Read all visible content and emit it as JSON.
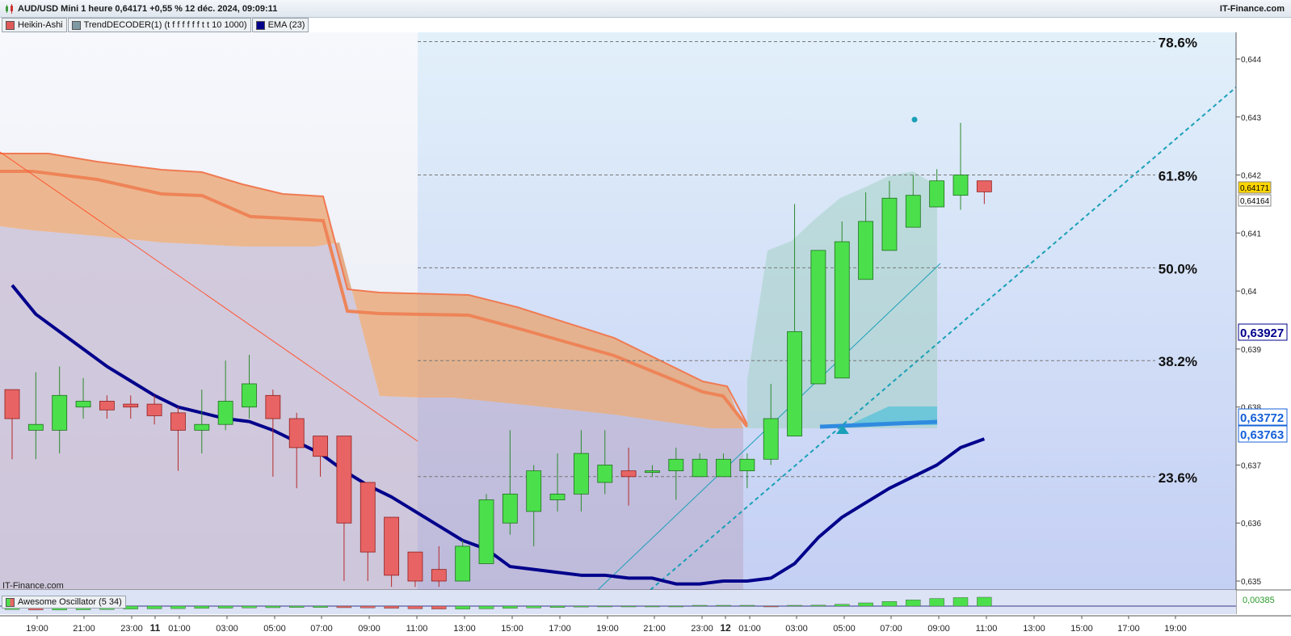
{
  "header": {
    "title": "AUD/USD Mini 1 heure 0,64171 +0,55 % 12 déc. 2024, 09:09:11",
    "brand": "IT-Finance.com"
  },
  "legend": [
    {
      "label": "Heikin-Ashi",
      "color": "#e05a5a"
    },
    {
      "label": "TrendDECODER(1) (t f f f f f f t t 10 1000)",
      "color": "#7f99a3"
    },
    {
      "label": "EMA (23)",
      "color": "#00008b"
    }
  ],
  "watermark": "IT-Finance.com",
  "oscillator": {
    "label": "Awesome Oscillator (5 34)",
    "value_label": "0,00385"
  },
  "chart_data": {
    "type": "candlestick",
    "title": "",
    "xlabel": "",
    "ylabel": "",
    "ylim": [
      0.6345,
      0.6445
    ],
    "y_ticks": [
      "0,644",
      "0,643",
      "0,642",
      "0,641",
      "0,64",
      "0,639",
      "0,638",
      "0,637",
      "0,636",
      "0,635"
    ],
    "x_ticks": [
      "19:00",
      "21:00",
      "23:00",
      "11",
      "01:00",
      "03:00",
      "05:00",
      "07:00",
      "09:00",
      "11:00",
      "13:00",
      "15:00",
      "17:00",
      "19:00",
      "21:00",
      "23:00",
      "12",
      "01:00",
      "03:00",
      "05:00",
      "07:00",
      "09:00",
      "11:00",
      "13:00",
      "15:00",
      "17:00",
      "19:00"
    ],
    "x_tick_bold": [
      "11",
      "12"
    ],
    "candles": [
      {
        "o": 0.6383,
        "h": 0.6383,
        "l": 0.6371,
        "c": 0.6378
      },
      {
        "o": 0.6376,
        "h": 0.6386,
        "l": 0.6371,
        "c": 0.6377
      },
      {
        "o": 0.6376,
        "h": 0.6387,
        "l": 0.6372,
        "c": 0.6382
      },
      {
        "o": 0.638,
        "h": 0.6385,
        "l": 0.6378,
        "c": 0.6381
      },
      {
        "o": 0.6381,
        "h": 0.6382,
        "l": 0.6378,
        "c": 0.63795
      },
      {
        "o": 0.63805,
        "h": 0.6382,
        "l": 0.6378,
        "c": 0.638
      },
      {
        "o": 0.63805,
        "h": 0.6382,
        "l": 0.6377,
        "c": 0.63785
      },
      {
        "o": 0.6379,
        "h": 0.638,
        "l": 0.6369,
        "c": 0.6376
      },
      {
        "o": 0.6376,
        "h": 0.6383,
        "l": 0.6372,
        "c": 0.6377
      },
      {
        "o": 0.6377,
        "h": 0.6388,
        "l": 0.6376,
        "c": 0.6381
      },
      {
        "o": 0.638,
        "h": 0.6389,
        "l": 0.6378,
        "c": 0.6384
      },
      {
        "o": 0.6382,
        "h": 0.6383,
        "l": 0.6368,
        "c": 0.6378
      },
      {
        "o": 0.6378,
        "h": 0.6379,
        "l": 0.6366,
        "c": 0.6373
      },
      {
        "o": 0.6375,
        "h": 0.6375,
        "l": 0.6368,
        "c": 0.63715
      },
      {
        "o": 0.6375,
        "h": 0.6375,
        "l": 0.635,
        "c": 0.636
      },
      {
        "o": 0.6367,
        "h": 0.6367,
        "l": 0.635,
        "c": 0.6355
      },
      {
        "o": 0.6361,
        "h": 0.6361,
        "l": 0.6349,
        "c": 0.6351
      },
      {
        "o": 0.6355,
        "h": 0.6355,
        "l": 0.6349,
        "c": 0.635
      },
      {
        "o": 0.6352,
        "h": 0.6356,
        "l": 0.6349,
        "c": 0.635
      },
      {
        "o": 0.635,
        "h": 0.6357,
        "l": 0.635,
        "c": 0.6356
      },
      {
        "o": 0.6353,
        "h": 0.6365,
        "l": 0.6353,
        "c": 0.6364
      },
      {
        "o": 0.636,
        "h": 0.6376,
        "l": 0.6358,
        "c": 0.6365
      },
      {
        "o": 0.6362,
        "h": 0.637,
        "l": 0.6356,
        "c": 0.6369
      },
      {
        "o": 0.6364,
        "h": 0.6372,
        "l": 0.6362,
        "c": 0.6365
      },
      {
        "o": 0.6365,
        "h": 0.6376,
        "l": 0.6362,
        "c": 0.6372
      },
      {
        "o": 0.6367,
        "h": 0.6376,
        "l": 0.6365,
        "c": 0.637
      },
      {
        "o": 0.6369,
        "h": 0.6373,
        "l": 0.6363,
        "c": 0.6368
      },
      {
        "o": 0.6369,
        "h": 0.637,
        "l": 0.6368,
        "c": 0.6369
      },
      {
        "o": 0.6369,
        "h": 0.6373,
        "l": 0.6364,
        "c": 0.6371
      },
      {
        "o": 0.6368,
        "h": 0.6372,
        "l": 0.6368,
        "c": 0.6371
      },
      {
        "o": 0.6368,
        "h": 0.6372,
        "l": 0.6368,
        "c": 0.6371
      },
      {
        "o": 0.6369,
        "h": 0.6372,
        "l": 0.6366,
        "c": 0.6371
      },
      {
        "o": 0.6371,
        "h": 0.6384,
        "l": 0.637,
        "c": 0.6378
      },
      {
        "o": 0.6375,
        "h": 0.6415,
        "l": 0.6375,
        "c": 0.6393
      },
      {
        "o": 0.6384,
        "h": 0.6407,
        "l": 0.6384,
        "c": 0.6407
      },
      {
        "o": 0.6385,
        "h": 0.6412,
        "l": 0.6385,
        "c": 0.64085
      },
      {
        "o": 0.6402,
        "h": 0.6417,
        "l": 0.6402,
        "c": 0.6412
      },
      {
        "o": 0.6407,
        "h": 0.6419,
        "l": 0.6407,
        "c": 0.6416
      },
      {
        "o": 0.6411,
        "h": 0.642,
        "l": 0.6411,
        "c": 0.64165
      },
      {
        "o": 0.64145,
        "h": 0.6421,
        "l": 0.64145,
        "c": 0.6419
      },
      {
        "o": 0.64165,
        "h": 0.6429,
        "l": 0.6414,
        "c": 0.642
      },
      {
        "o": 0.6419,
        "h": 0.6419,
        "l": 0.6415,
        "c": 0.64171
      }
    ],
    "ema": [
      0.6401,
      0.6396,
      0.6393,
      0.639,
      0.6387,
      0.63845,
      0.6382,
      0.638,
      0.6379,
      0.6378,
      0.63775,
      0.6376,
      0.6374,
      0.6372,
      0.6369,
      0.63665,
      0.63645,
      0.6362,
      0.63595,
      0.6357,
      0.63555,
      0.63525,
      0.6352,
      0.63515,
      0.6351,
      0.6351,
      0.63505,
      0.63505,
      0.63495,
      0.63495,
      0.635,
      0.635,
      0.63505,
      0.6353,
      0.63575,
      0.6361,
      0.63635,
      0.6366,
      0.6368,
      0.637,
      0.6373,
      0.63745
    ],
    "fibonacci": [
      {
        "level": "78.6%",
        "price": 0.6443
      },
      {
        "level": "61.8%",
        "price": 0.642
      },
      {
        "level": "50.0%",
        "price": 0.6404
      },
      {
        "level": "38.2%",
        "price": 0.6388
      },
      {
        "level": "23.6%",
        "price": 0.6368
      }
    ],
    "price_labels": [
      {
        "text": "0,64171",
        "price": 0.64171,
        "bg": "#ffd500",
        "fg": "#000"
      },
      {
        "text": "0,64164",
        "price": 0.64164,
        "bg": "#ffffff",
        "fg": "#000"
      },
      {
        "text": "0,63927",
        "price": 0.63927,
        "bg": "#ffffff",
        "fg": "#00008b"
      },
      {
        "text": "0,63772",
        "price": 0.63772,
        "bg": "#ffffff",
        "fg": "#1560d8"
      },
      {
        "text": "0,63763",
        "price": 0.63763,
        "bg": "#ffffff",
        "fg": "#1560d8"
      }
    ],
    "awesome_oscillator": [
      -0.0015,
      -0.0017,
      -0.0017,
      -0.0016,
      -0.0015,
      -0.0013,
      -0.0012,
      -0.0011,
      -0.001,
      -0.0009,
      -0.0008,
      -0.0007,
      -0.0006,
      -0.0006,
      -0.0007,
      -0.0008,
      -0.001,
      -0.0012,
      -0.0013,
      -0.0013,
      -0.0012,
      -0.001,
      -0.0008,
      -0.0006,
      -0.0004,
      -0.0003,
      -0.0002,
      -0.0001,
      -5e-05,
      2e-05,
      5e-05,
      8e-05,
      -5e-05,
      0.0,
      0.0004,
      0.0008,
      0.0014,
      0.002,
      0.0027,
      0.0033,
      0.0037,
      0.00385
    ],
    "colors": {
      "up": "#4be04b",
      "down": "#e86464",
      "ema": "#00008b",
      "cloud": "#e9a36c",
      "fib": "#777777",
      "trendline": "#1aa0b8"
    }
  }
}
